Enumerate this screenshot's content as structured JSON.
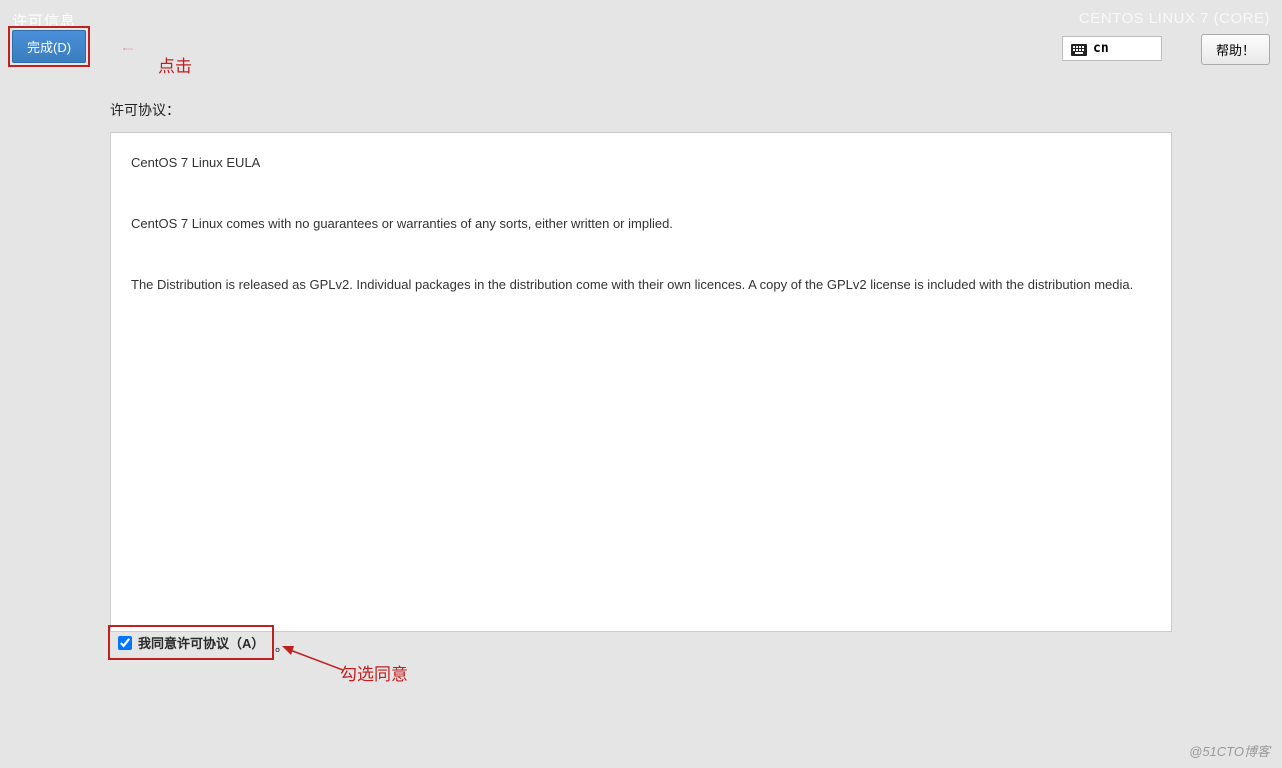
{
  "header": {
    "page_title_faded": "许可信息",
    "os_title": "CENTOS LINUX 7 (CORE)",
    "done_button": "完成(D)",
    "lang_code": "cn",
    "help_button": "帮助！"
  },
  "annotations": {
    "click_label": "点击",
    "check_label": "勾选同意"
  },
  "license": {
    "label": "许可协议：",
    "eula_title": "CentOS 7 Linux EULA",
    "para1": "CentOS 7 Linux comes with no guarantees or warranties of any sorts, either written or implied.",
    "para2": "The Distribution is released as GPLv2. Individual packages in the distribution come with their own licences. A copy of the GPLv2 license is included with the distribution media."
  },
  "agree": {
    "label": "我同意许可协议（A）",
    "period": "。",
    "checked": true
  },
  "watermark": "@51CTO博客"
}
